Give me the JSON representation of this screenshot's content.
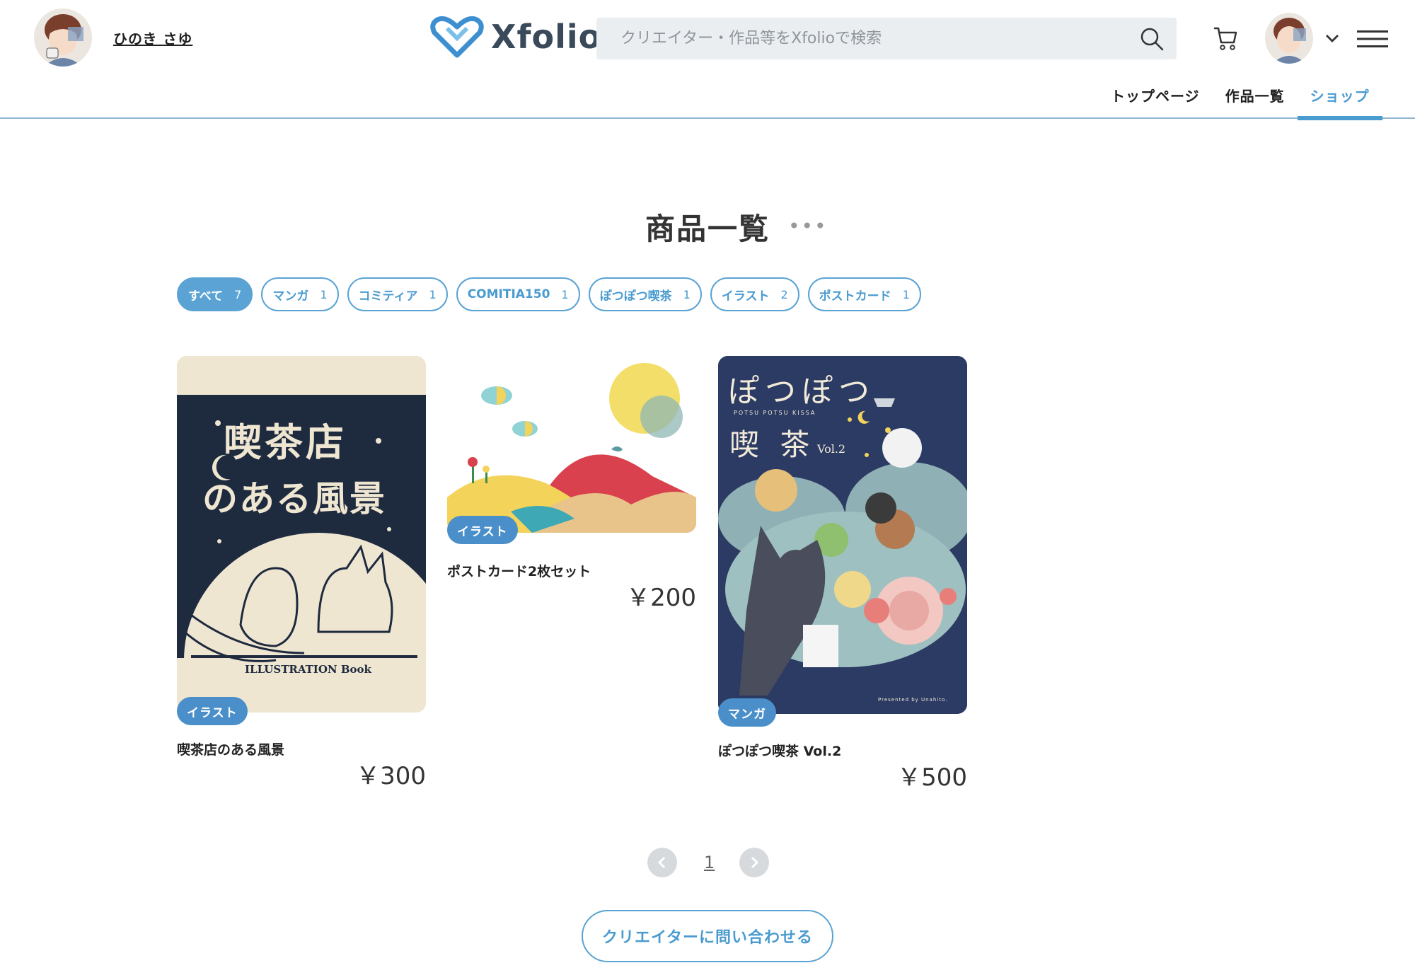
{
  "creator": {
    "name": "ひのき さゆ"
  },
  "brand": {
    "name": "Xfolio",
    "accent": "#4a9bd0"
  },
  "search": {
    "placeholder": "クリエイター・作品等をXfolioで検索"
  },
  "nav": {
    "items": [
      {
        "label": "トップページ"
      },
      {
        "label": "作品一覧"
      },
      {
        "label": "ショップ",
        "active": true
      }
    ]
  },
  "page": {
    "title": "商品一覧",
    "more": "•••"
  },
  "filters": [
    {
      "label": "すべて",
      "count": "7",
      "active": true
    },
    {
      "label": "マンガ",
      "count": "1"
    },
    {
      "label": "コミティア",
      "count": "1"
    },
    {
      "label": "COMITIA150",
      "count": "1"
    },
    {
      "label": "ぽつぽつ喫茶",
      "count": "1"
    },
    {
      "label": "イラスト",
      "count": "2"
    },
    {
      "label": "ポストカード",
      "count": "1"
    }
  ],
  "products": [
    {
      "tag": "イラスト",
      "name": "喫茶店のある風景",
      "price": "￥300",
      "cover": {
        "title_line1": "喫茶店",
        "title_line2": "のある風景",
        "subtitle": "ILLUSTRATION Book"
      }
    },
    {
      "tag": "イラスト",
      "name": "ポストカード2枚セット",
      "price": "￥200"
    },
    {
      "tag": "マンガ",
      "name": "ぽつぽつ喫茶 Vol.2",
      "price": "￥500",
      "cover": {
        "title_line1": "ぽつぽつ",
        "kana": "POTSU POTSU KISSA",
        "title_line2": "喫 茶",
        "vol": "Vol.2",
        "credit": "Presented by Unahito."
      }
    }
  ],
  "pagination": {
    "current": "1"
  },
  "contact": {
    "label": "クリエイターに問い合わせる"
  }
}
